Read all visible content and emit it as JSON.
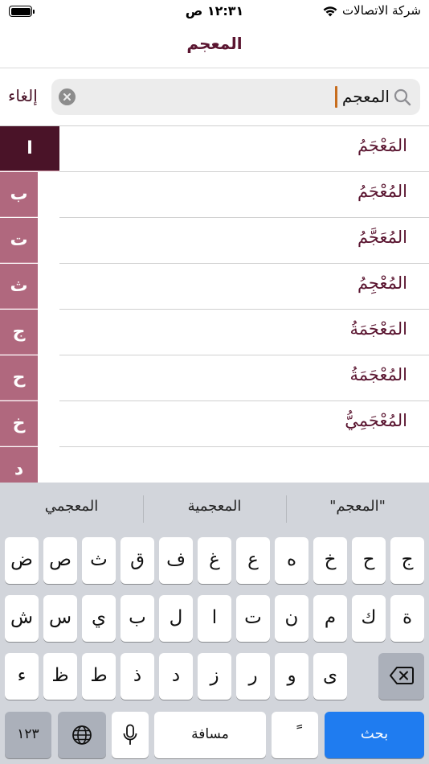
{
  "status_bar": {
    "time": "١٢:٣١ ص",
    "carrier": "شركة الاتصالات",
    "icons": [
      "battery-icon",
      "wifi-icon"
    ]
  },
  "nav": {
    "title": "المعجم"
  },
  "search": {
    "value": "المعجم",
    "cancel_label": "إلغاء",
    "icons": [
      "search-icon",
      "clear-icon"
    ]
  },
  "results": [
    "المَعْجَمُ",
    "المُعْجَمُ",
    "المُعَجَّمُ",
    "المُعْجِمُ",
    "المَعْجَمَةُ",
    "المُعْجَمَةُ",
    "المُعْجَمِيُّ"
  ],
  "letter_index": [
    "ا",
    "ب",
    "ت",
    "ث",
    "ج",
    "ح",
    "خ",
    "د"
  ],
  "active_letter": "ا",
  "keyboard": {
    "suggestions": [
      "\"المعجم\"",
      "المعجمية",
      "المعجمي"
    ],
    "row1": [
      "ج",
      "ح",
      "خ",
      "ه",
      "ع",
      "غ",
      "ف",
      "ق",
      "ث",
      "ص",
      "ض"
    ],
    "row2": [
      "ة",
      "ك",
      "م",
      "ن",
      "ت",
      "ا",
      "ل",
      "ب",
      "ي",
      "س",
      "ش"
    ],
    "row3": [
      "ى",
      "و",
      "ر",
      "ز",
      "د",
      "ذ",
      "ط",
      "ظ",
      "ء"
    ],
    "numbers_key": "١٢٣",
    "tanween_key": "ً",
    "space_key": "مسافة",
    "search_key": "بحث",
    "icons": [
      "delete-key-icon",
      "globe-icon",
      "microphone-icon"
    ]
  },
  "colors": {
    "accent": "#5a1530",
    "index_active": "#4a1328",
    "index_inactive": "#b0687e",
    "search_key": "#1f7cf0"
  }
}
